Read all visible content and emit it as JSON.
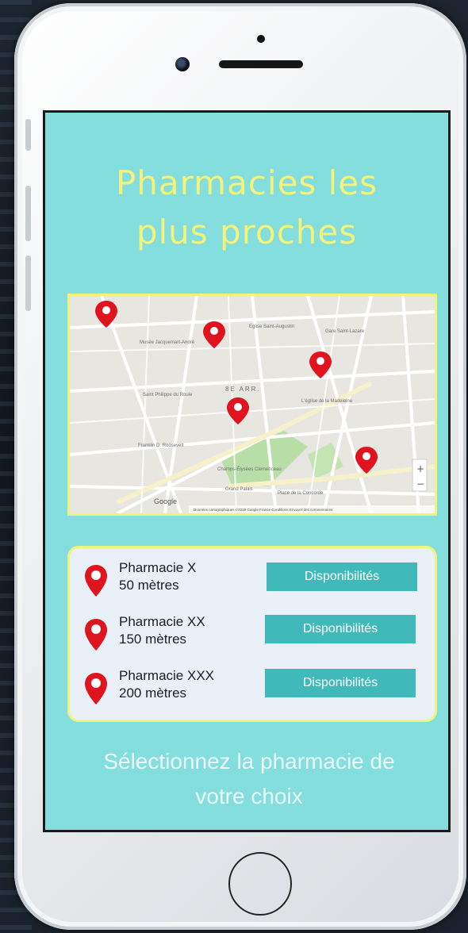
{
  "screen": {
    "title_line1": "Pharmacies les",
    "title_line2": "plus proches",
    "instruction_line1": "Sélectionnez la pharmacie de",
    "instruction_line2": "votre choix"
  },
  "pharmacies": [
    {
      "name": "Pharmacie X",
      "distance": "50 mètres",
      "button_label": "Disponibilités"
    },
    {
      "name": "Pharmacie XX",
      "distance": "150 mètres",
      "button_label": "Disponibilités"
    },
    {
      "name": "Pharmacie XXX",
      "distance": "200 mètres",
      "button_label": "Disponibilités"
    }
  ],
  "map": {
    "labels": {
      "district": "8E ARR.",
      "stlazare": "Gare Saint-Lazare",
      "augustin": "Eglise Saint-Augustin",
      "madeleine": "L'église de la Madeleine",
      "jacquemart": "Musée Jacquemart-André",
      "philippe": "Saint Philippe du Roule",
      "roosevelt": "Franklin D. Roosevelt",
      "champs": "Champs-Élysées Clemenceau",
      "grandpalais": "Grand Palais",
      "concorde": "Place de la Concorde",
      "google": "Google",
      "footer": "Données cartographiques ©2019 Google   France   Conditions   Envoyer des commentaires"
    }
  },
  "colors": {
    "screen_bg": "#84dedd",
    "title": "#f3f27a",
    "button": "#3fb9ba",
    "pin": "#e0141e",
    "card_bg": "#eaf0f8"
  },
  "icons": {
    "map_pin": "map-pin-icon",
    "zoom_in": "plus-icon",
    "zoom_out": "minus-icon",
    "home": "home-button"
  }
}
